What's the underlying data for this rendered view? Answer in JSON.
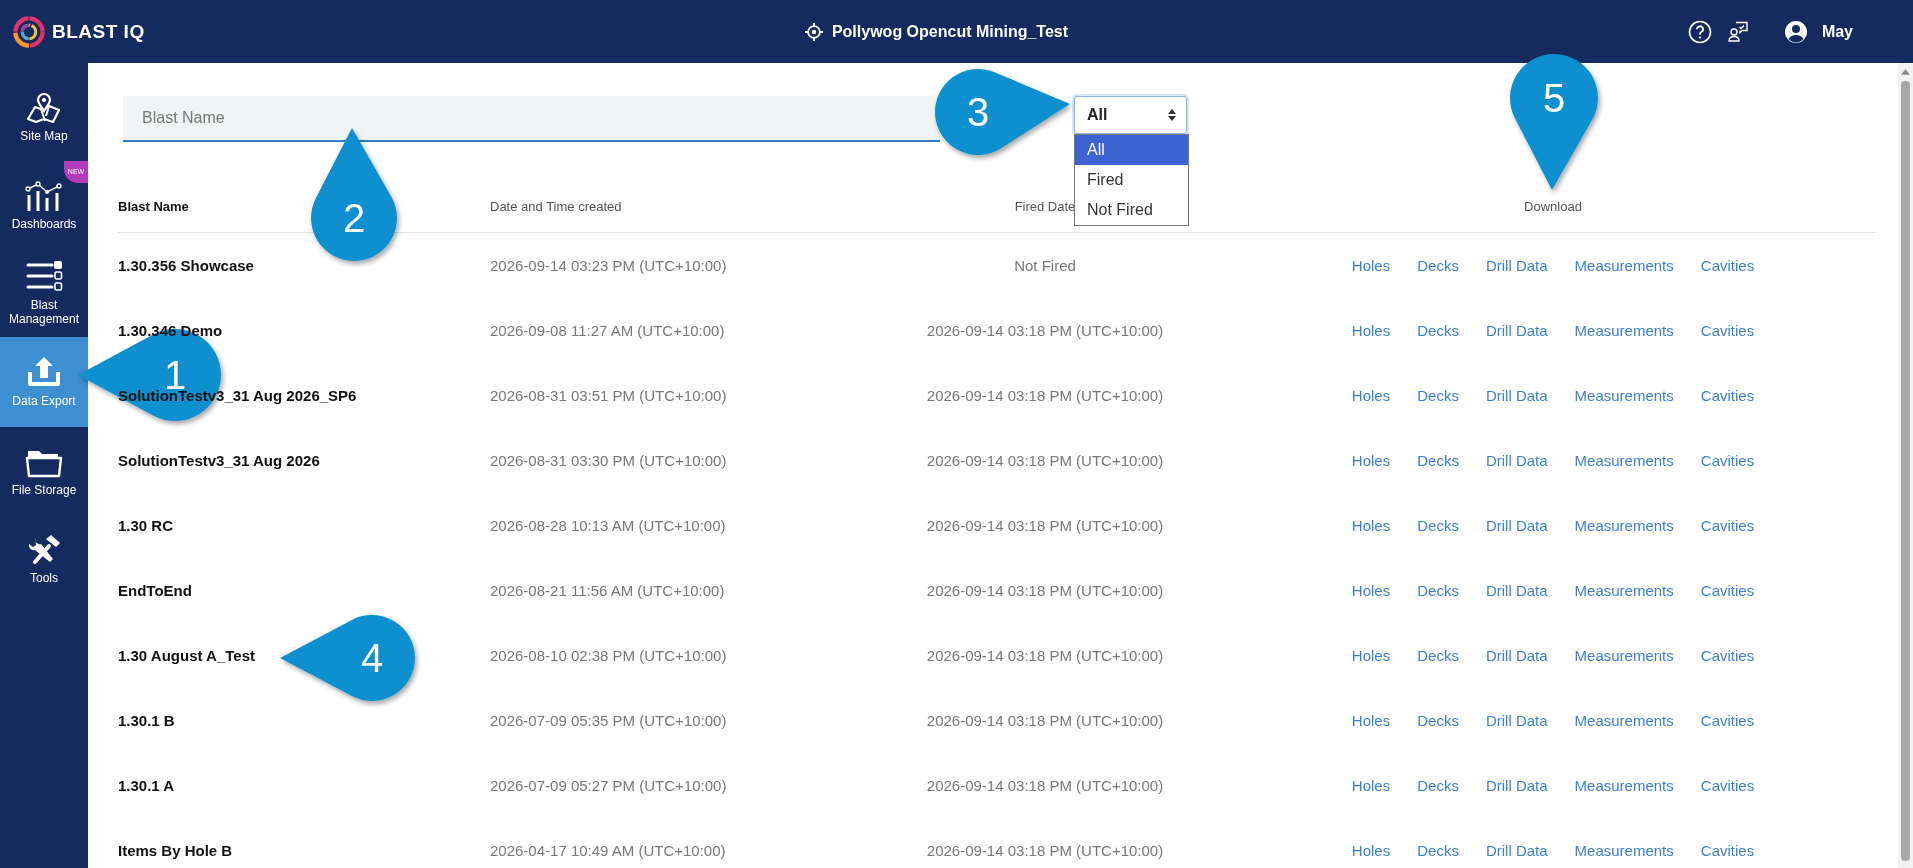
{
  "header": {
    "brand": "BLAST",
    "brand_suffix": "IQ",
    "project": "Pollywog Opencut Mining_Test",
    "user": "May"
  },
  "sidebar": {
    "items": [
      {
        "label": "Site Map",
        "kind": "map",
        "selected": false
      },
      {
        "label": "Dashboards",
        "kind": "chart",
        "selected": false,
        "badge": "NEW"
      },
      {
        "label": "Blast Management",
        "kind": "list",
        "selected": false
      },
      {
        "label": "Data Export",
        "kind": "export",
        "selected": true
      },
      {
        "label": "File Storage",
        "kind": "folder",
        "selected": false
      },
      {
        "label": "Tools",
        "kind": "tools",
        "selected": false
      }
    ]
  },
  "search": {
    "placeholder": "Blast Name"
  },
  "filter": {
    "value": "All",
    "options": [
      {
        "label": "All",
        "selected": true
      },
      {
        "label": "Fired",
        "selected": false
      },
      {
        "label": "Not Fired",
        "selected": false
      }
    ]
  },
  "table": {
    "columns": [
      "Blast Name",
      "Date and Time created",
      "Fired Date",
      "Download"
    ],
    "rows": [
      {
        "name": "1.30.356 Showcase",
        "created": "2026-09-14 03:23 PM (UTC+10:00)",
        "fired": "Not Fired",
        "downloads": [
          "Holes",
          "Decks",
          "Drill Data",
          "Measurements",
          "Cavities"
        ]
      },
      {
        "name": "1.30.346 Demo",
        "created": "2026-09-08 11:27 AM (UTC+10:00)",
        "fired": "2026-09-14 03:18 PM (UTC+10:00)",
        "downloads": [
          "Holes",
          "Decks",
          "Drill Data",
          "Measurements",
          "Cavities"
        ]
      },
      {
        "name": "SolutionTestv3_31 Aug 2026_SP6",
        "created": "2026-08-31 03:51 PM (UTC+10:00)",
        "fired": "2026-09-14 03:18 PM (UTC+10:00)",
        "downloads": [
          "Holes",
          "Decks",
          "Drill Data",
          "Measurements",
          "Cavities"
        ]
      },
      {
        "name": "SolutionTestv3_31 Aug 2026",
        "created": "2026-08-31 03:30 PM (UTC+10:00)",
        "fired": "2026-09-14 03:18 PM (UTC+10:00)",
        "downloads": [
          "Holes",
          "Decks",
          "Drill Data",
          "Measurements",
          "Cavities"
        ]
      },
      {
        "name": "1.30 RC",
        "created": "2026-08-28 10:13 AM (UTC+10:00)",
        "fired": "2026-09-14 03:18 PM (UTC+10:00)",
        "downloads": [
          "Holes",
          "Decks",
          "Drill Data",
          "Measurements",
          "Cavities"
        ]
      },
      {
        "name": "EndToEnd",
        "created": "2026-08-21 11:56 AM (UTC+10:00)",
        "fired": "2026-09-14 03:18 PM (UTC+10:00)",
        "downloads": [
          "Holes",
          "Decks",
          "Drill Data",
          "Measurements",
          "Cavities"
        ]
      },
      {
        "name": "1.30 August A_Test",
        "created": "2026-08-10 02:38 PM (UTC+10:00)",
        "fired": "2026-09-14 03:18 PM (UTC+10:00)",
        "downloads": [
          "Holes",
          "Decks",
          "Drill Data",
          "Measurements",
          "Cavities"
        ]
      },
      {
        "name": "1.30.1 B",
        "created": "2026-07-09 05:35 PM (UTC+10:00)",
        "fired": "2026-09-14 03:18 PM (UTC+10:00)",
        "downloads": [
          "Holes",
          "Decks",
          "Drill Data",
          "Measurements",
          "Cavities"
        ]
      },
      {
        "name": "1.30.1 A",
        "created": "2026-07-09 05:27 PM (UTC+10:00)",
        "fired": "2026-09-14 03:18 PM (UTC+10:00)",
        "downloads": [
          "Holes",
          "Decks",
          "Drill Data",
          "Measurements",
          "Cavities"
        ]
      },
      {
        "name": "Items By Hole B",
        "created": "2026-04-17 10:49 AM (UTC+10:00)",
        "fired": "2026-09-14 03:18 PM (UTC+10:00)",
        "downloads": [
          "Holes",
          "Decks",
          "Drill Data",
          "Measurements",
          "Cavities"
        ]
      }
    ]
  },
  "callouts": [
    {
      "label": "1"
    },
    {
      "label": "2"
    },
    {
      "label": "3"
    },
    {
      "label": "4"
    },
    {
      "label": "5"
    }
  ]
}
